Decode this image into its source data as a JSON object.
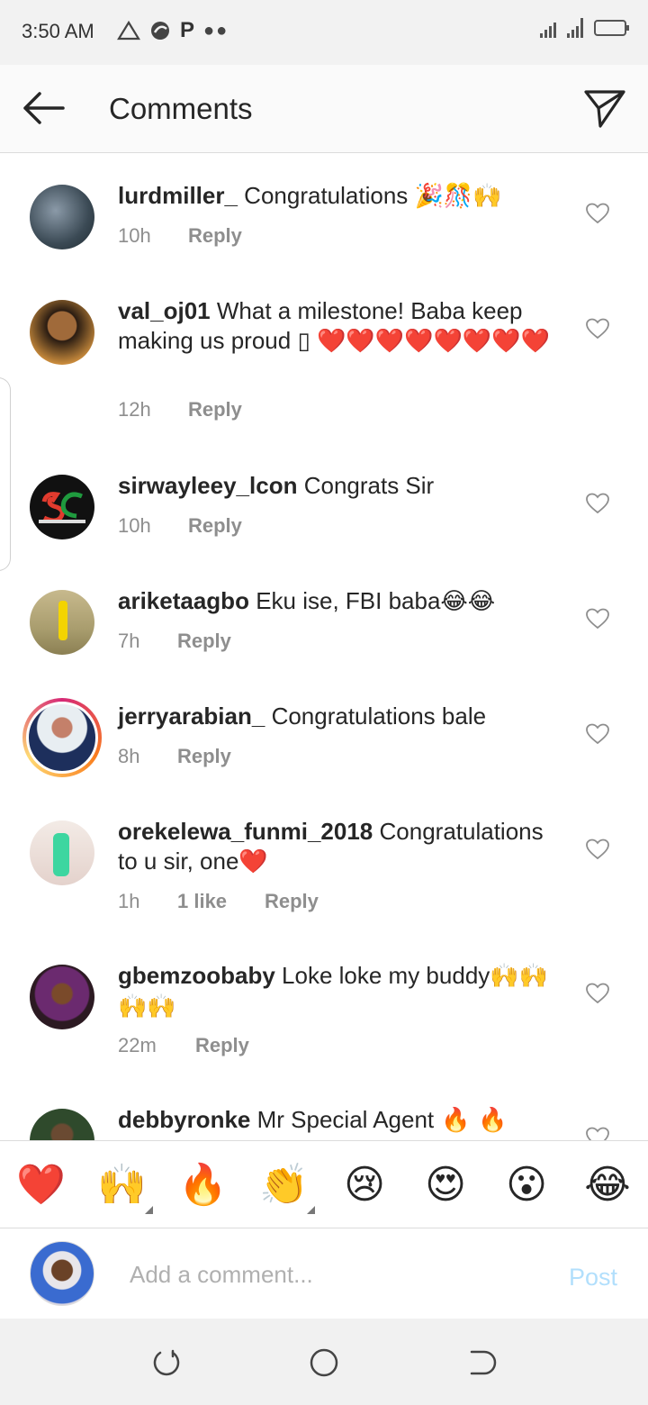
{
  "status_bar": {
    "time": "3:50 AM",
    "left_icons": [
      "alert-triangle-icon",
      "app-icon",
      "p-icon",
      "more-dots-icon"
    ],
    "right_icons": [
      "signal-icon",
      "signal-4g-icon",
      "battery-icon"
    ]
  },
  "header": {
    "title": "Comments",
    "back_icon": "arrow-left-icon",
    "share_icon": "paper-plane-icon"
  },
  "comments": [
    {
      "username": "lurdmiller_",
      "text": "Congratulations",
      "emoji": "🎉🎊🙌",
      "time": "10h",
      "likes": "",
      "reply": "Reply"
    },
    {
      "username": "val_oj01",
      "text": "What a milestone! Baba keep making us proud ▯",
      "emoji": "❤️❤️❤️❤️❤️❤️❤️❤️",
      "time": "12h",
      "likes": "",
      "reply": "Reply"
    },
    {
      "username": "sirwayleey_lcon",
      "text": "Congrats Sir",
      "emoji": "",
      "time": "10h",
      "likes": "",
      "reply": "Reply"
    },
    {
      "username": "ariketaagbo",
      "text": "Eku ise, FBI baba",
      "emoji": "😂😂",
      "time": "7h",
      "likes": "",
      "reply": "Reply"
    },
    {
      "username": "jerryarabian_",
      "text": "Congratulations bale",
      "emoji": "",
      "time": "8h",
      "likes": "",
      "reply": "Reply"
    },
    {
      "username": "orekelewa_funmi_2018",
      "text": "Congratulations to u sir, one",
      "emoji": "❤️",
      "time": "1h",
      "likes": "1 like",
      "reply": "Reply"
    },
    {
      "username": "gbemzoobaby",
      "text": "Loke loke my buddy",
      "emoji": "🙌🙌🙌🙌",
      "time": "22m",
      "likes": "",
      "reply": "Reply"
    },
    {
      "username": "debbyronke",
      "text": "Mr Special Agent",
      "emoji": " 🔥 🔥",
      "time": "",
      "likes": "",
      "reply": ""
    }
  ],
  "emoji_bar": [
    "❤️",
    "🙌",
    "🔥",
    "👏",
    "😢",
    "😍",
    "😮",
    "😂"
  ],
  "composer": {
    "placeholder": "Add a comment...",
    "post_label": "Post"
  },
  "nav_bar": {
    "icons": [
      "recents-icon",
      "home-icon",
      "back-icon"
    ]
  },
  "colors": {
    "text": "#262626",
    "secondary": "#8e8e8e",
    "post_disabled": "#b2dffc",
    "heart_red": "#ed4956"
  }
}
